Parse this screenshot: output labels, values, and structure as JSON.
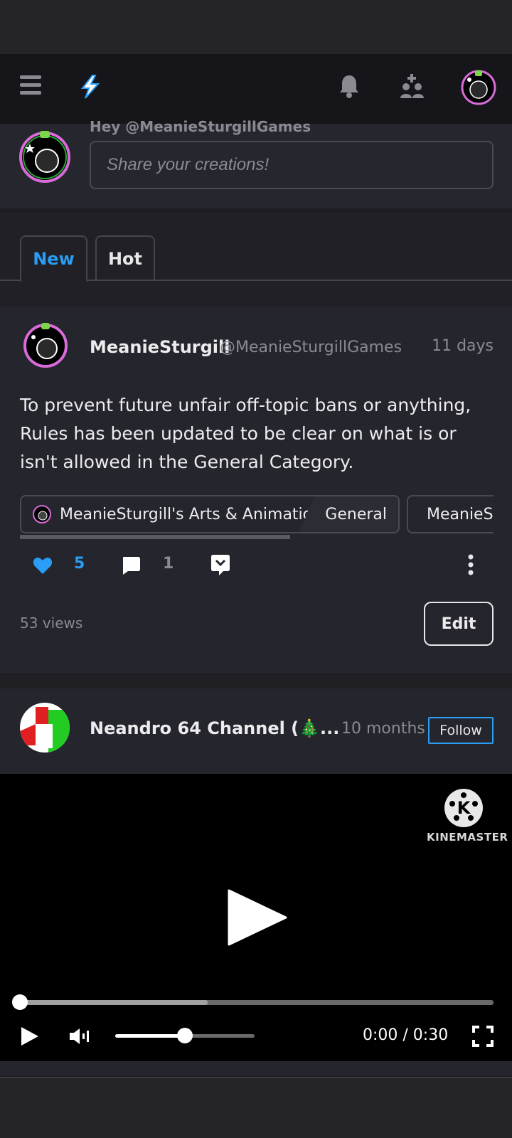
{
  "composer": {
    "greeting": "Hey @MeanieSturgillGames",
    "placeholder": "Share your creations!"
  },
  "tabs": [
    {
      "label": "New",
      "active": true
    },
    {
      "label": "Hot",
      "active": false
    }
  ],
  "post1": {
    "author": "MeanieSturgill",
    "handle": "@MeanieSturgillGames",
    "time": "11 days",
    "body": "To prevent future unfair off-topic bans or anything, Rules has been updated to be clear on what is or isn't allowed in the General Category.",
    "chips": [
      {
        "name": "MeanieSturgill's Arts & Animations",
        "category": "General"
      },
      {
        "name": "MeanieSturgill's Arts & Animations"
      }
    ],
    "likes": "5",
    "comments": "1",
    "views": "53 views",
    "edit_label": "Edit"
  },
  "post2": {
    "author": "Neandro 64 Channel (🎄...",
    "time": "10 months",
    "follow_label": "Follow"
  },
  "video": {
    "brand": "KINEMASTER",
    "timecode": "0:00 / 0:30",
    "progress": 0.0,
    "volume": 0.5
  },
  "colors": {
    "accent": "#2a9df4",
    "background": "#25252d"
  }
}
